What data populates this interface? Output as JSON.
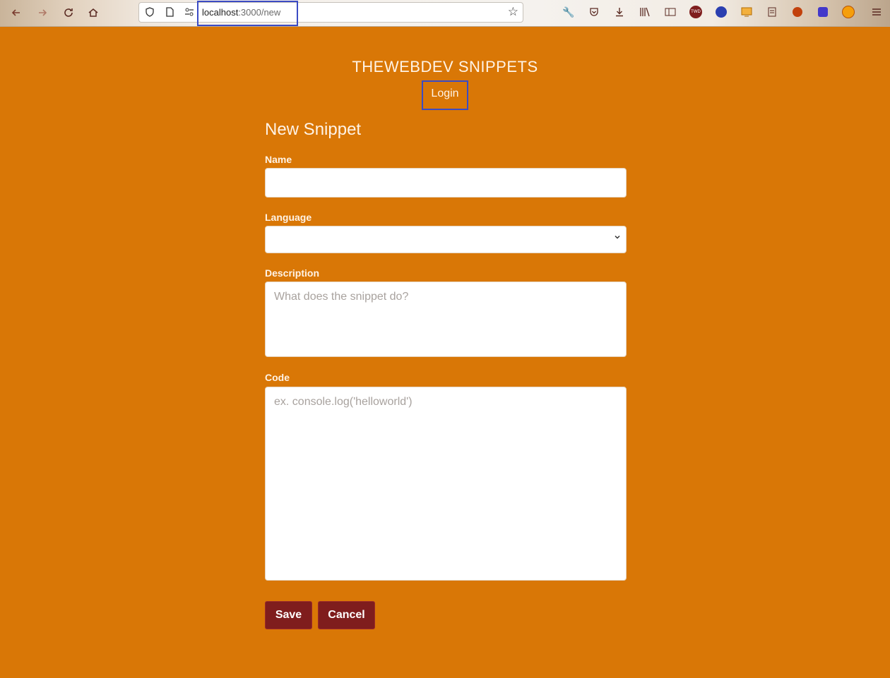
{
  "browser": {
    "url_host": "localhost",
    "url_path": ":3000/new",
    "icons": {
      "back": "arrow-left-icon",
      "forward": "arrow-right-icon",
      "reload": "reload-icon",
      "home": "home-icon",
      "shield": "shield-icon",
      "page": "page-icon",
      "bookmark": "star-icon"
    },
    "toolbar_icons": [
      "wrench-icon",
      "pocket-icon",
      "download-icon",
      "library-icon",
      "reader-icon",
      "twd-icon",
      "globe-icon",
      "screenshot-icon",
      "notes-icon",
      "paw-icon",
      "extension-icon",
      "fox-icon",
      "menu-icon"
    ]
  },
  "header": {
    "site_title": "THEWEBDEV SNIPPETS",
    "login_label": "Login"
  },
  "form": {
    "heading": "New Snippet",
    "name_label": "Name",
    "name_value": "",
    "language_label": "Language",
    "language_value": "",
    "description_label": "Description",
    "description_placeholder": "What does the snippet do?",
    "code_label": "Code",
    "code_placeholder": "ex. console.log('helloworld')",
    "save_label": "Save",
    "cancel_label": "Cancel"
  },
  "colors": {
    "page_background": "#d97706",
    "button_background": "#7f1d1d",
    "highlight_box": "#3b4bc4"
  }
}
